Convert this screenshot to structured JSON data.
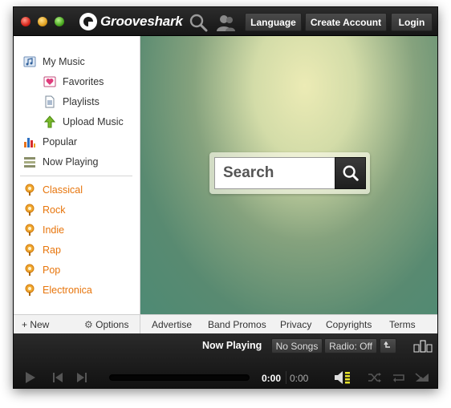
{
  "app": {
    "name": "Grooveshark"
  },
  "topbar": {
    "language_label": "Language",
    "create_account_label": "Create Account",
    "login_label": "Login",
    "icons": [
      "search-icon",
      "user-icon"
    ]
  },
  "sidebar": {
    "my_music": "My Music",
    "favorites": "Favorites",
    "playlists": "Playlists",
    "upload_music": "Upload Music",
    "popular": "Popular",
    "now_playing": "Now Playing",
    "genres": [
      "Classical",
      "Rock",
      "Indie",
      "Rap",
      "Pop",
      "Electronica"
    ],
    "footer": {
      "new_label": "+ New",
      "options_label": "Options"
    }
  },
  "search": {
    "placeholder": "Search"
  },
  "footer_links": [
    "Advertise",
    "Band Promos",
    "Privacy",
    "Copyrights",
    "Terms"
  ],
  "player": {
    "now_playing_label": "Now Playing",
    "no_songs_label": "No Songs",
    "radio_label": "Radio: Off",
    "current_time": "0:00",
    "total_time": "0:00",
    "progress": 0
  },
  "colors": {
    "genre_accent": "#e7750c",
    "dark_chrome": "#1b1b1b",
    "volume_accent": "#e6e22a"
  }
}
